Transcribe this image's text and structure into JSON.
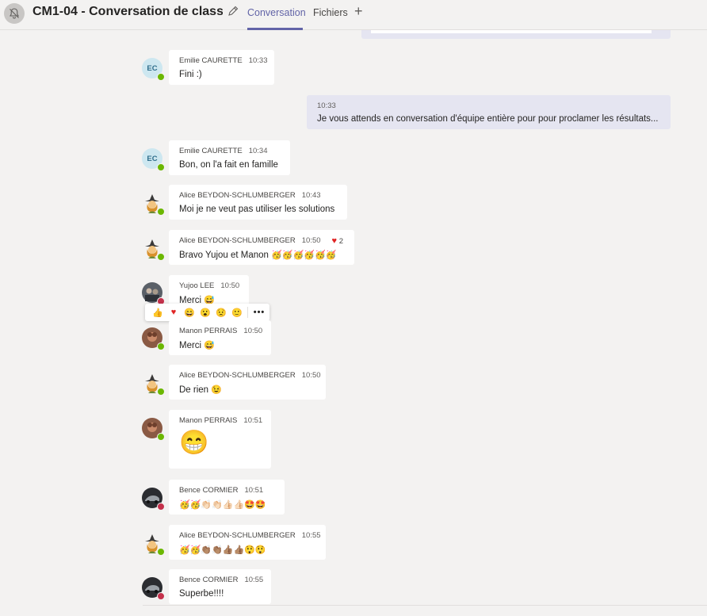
{
  "header": {
    "title": "CM1-04 - Conversation de class...",
    "tabs": [
      {
        "label": "Conversation",
        "active": true
      },
      {
        "label": "Fichiers",
        "active": false
      }
    ],
    "accent_color": "#6264a7"
  },
  "messages": [
    {
      "author": "Emilie CAURETTE",
      "initials": "EC",
      "time": "10:33",
      "text": "Fini :)",
      "presence": "available"
    },
    {
      "author": "",
      "time": "10:33",
      "text": "Je vous attends en conversation d'équipe entière pour pour proclamer les résultats...",
      "mine": true
    },
    {
      "author": "Emilie CAURETTE",
      "initials": "EC",
      "time": "10:34",
      "text": "Bon, on l'a fait en famille",
      "presence": "available"
    },
    {
      "author": "Alice BEYDON-SCHLUMBERGER",
      "time": "10:43",
      "text": "Moi je ne veut pas utiliser les solutions",
      "presence": "available"
    },
    {
      "author": "Alice BEYDON-SCHLUMBERGER",
      "time": "10:50",
      "text": "Bravo Yujou et Manon",
      "emoji": "🥳🥳🥳🥳🥳🥳",
      "reaction": {
        "icon": "heart",
        "count": "2"
      },
      "presence": "available"
    },
    {
      "author": "Yujoo LEE",
      "time": "10:50",
      "text": "Merci",
      "emoji": "😅",
      "presence": "busy"
    },
    {
      "author": "Manon PERRAIS",
      "time": "10:50",
      "text": "Merci",
      "emoji": "😅",
      "presence": "available"
    },
    {
      "author": "Alice BEYDON-SCHLUMBERGER",
      "time": "10:50",
      "text": "De rien",
      "emoji": "😉",
      "presence": "available"
    },
    {
      "author": "Manon PERRAIS",
      "time": "10:51",
      "text": "",
      "emoji": "😁",
      "presence": "available"
    },
    {
      "author": "Bence CORMIER",
      "time": "10:51",
      "text": "",
      "emoji": "🥳🥳👏🏻👏🏻👍🏻👍🏻🤩🤩",
      "presence": "busy"
    },
    {
      "author": "Alice BEYDON-SCHLUMBERGER",
      "time": "10:55",
      "text": "",
      "emoji": "🥳🥳👏🏽👏🏽👍🏽👍🏽😲😲",
      "presence": "available"
    },
    {
      "author": "Bence CORMIER",
      "time": "10:55",
      "text": "Superbe!!!!",
      "presence": "busy"
    }
  ],
  "reaction_bar": {
    "icons": [
      "like-icon",
      "heart-icon",
      "laugh-icon",
      "surprised-icon",
      "sad-icon",
      "angry-icon",
      "more-icon"
    ],
    "glyphs": [
      "👍",
      "❤️",
      "😄",
      "😮",
      "😟",
      "🙂",
      "•••"
    ]
  }
}
